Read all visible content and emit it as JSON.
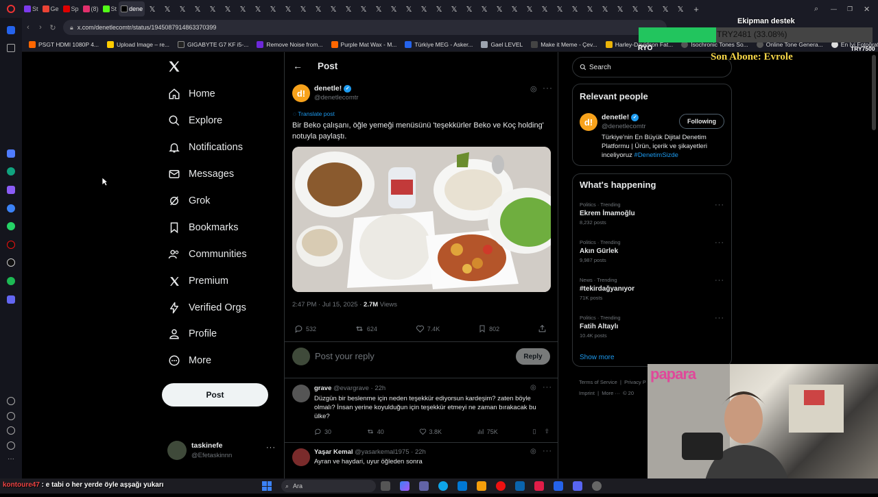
{
  "browser": {
    "tabs": [
      "St",
      "Ge",
      "Sp",
      "(8)",
      "St",
      "dene"
    ],
    "url": "x.com/denetlecomtr/status/1945087914863370399",
    "bookmarks": [
      "PSGT HDMI 1080P 4...",
      "Upload Image – re...",
      "GIGABYTE G7 KF i5-...",
      "Remove Noise from...",
      "Purple Mat Wax - M...",
      "Türkiye MEG - Asker...",
      "Gael LEVEL",
      "Make it Meme - Çev...",
      "Harley-Davidson Fat...",
      "Isochronic Tones So...",
      "Online Tone Genera...",
      "En İyi Fotoğraf ve Vi..."
    ]
  },
  "nav": {
    "items": [
      "Home",
      "Explore",
      "Notifications",
      "Messages",
      "Grok",
      "Bookmarks",
      "Communities",
      "Premium",
      "Verified Orgs",
      "Profile",
      "More"
    ],
    "post_button": "Post",
    "account_name": "taskinefe",
    "account_handle": "@Efetaskinnn"
  },
  "header": {
    "title": "Post"
  },
  "post": {
    "author": "denetle!",
    "handle": "@denetlecomtr",
    "translate": "Translate post",
    "text": "Bir Beko çalışanı, öğle yemeği menüsünü 'teşekkürler Beko ve Koç holding' notuyla paylaştı.",
    "time": "2:47 PM · Jul 15, 2025 · ",
    "views_count": "2.7M",
    "views_label": " Views",
    "replies": "532",
    "reposts": "624",
    "likes": "7.4K",
    "bookmarks": "802"
  },
  "reply_box": {
    "placeholder": "Post your reply",
    "button": "Reply"
  },
  "replies": [
    {
      "name": "grave",
      "handle": "@evargrave · 22h",
      "text": "Düzgün bir beslenme için neden teşekkür ediyorsun kardeşim? zaten böyle olmalı? İnsan yerine koyulduğun için teşekkür etmeyi ne zaman bırakacak bu ülke?",
      "replies": "30",
      "reposts": "40",
      "likes": "3.8K",
      "views": "75K"
    },
    {
      "name": "Yaşar Kemal",
      "handle": "@yasarkemal1975 · 22h",
      "text": "Ayran ve haydari, uyur öğleden sonra"
    }
  ],
  "search": {
    "placeholder": "Search"
  },
  "relevant": {
    "title": "Relevant people",
    "name": "denetle!",
    "handle": "@denetlecomtr",
    "follow": "Following",
    "bio": "Türkiye'nin En Büyük Dijital Denetim Platformu | Ürün, içerik ve şikayetleri inceliyoruz ",
    "hashtag": "#DenetimSizde"
  },
  "happening": {
    "title": "What's happening",
    "trends": [
      {
        "cat": "Politics · Trending",
        "name": "Ekrem İmamoğlu",
        "posts": "8,232 posts"
      },
      {
        "cat": "Politics · Trending",
        "name": "Akın Gürlek",
        "posts": "9,987 posts"
      },
      {
        "cat": "News · Trending",
        "name": "#tekirdağyanıyor",
        "posts": "71K posts"
      },
      {
        "cat": "Politics · Trending",
        "name": "Fatih Altaylı",
        "posts": "10.4K posts"
      }
    ],
    "show_more": "Show more"
  },
  "footer": {
    "terms": "Terms of Service",
    "privacy": "Privacy P",
    "imprint": "Imprint",
    "more": "More ···",
    "year": "© 20"
  },
  "overlay": {
    "title": "Ekipman destek",
    "amount": "TRY2481 (33.08%)",
    "progress_pct": 33.08,
    "left_label": "RYO",
    "right_label": "TRY7500",
    "subscriber": "Son Abone: Evrole",
    "sponsor": "papara"
  },
  "chat": {
    "user": "kontoure47",
    "message": " : e tabi o her yerde öyle aşşağı yukarı"
  },
  "taskbar": {
    "search": "Ara"
  },
  "colors": {
    "accent": "#1d9bf0",
    "brand": "#f7a21b",
    "progress": "#22c55e",
    "subscriber": "#f5d547"
  }
}
